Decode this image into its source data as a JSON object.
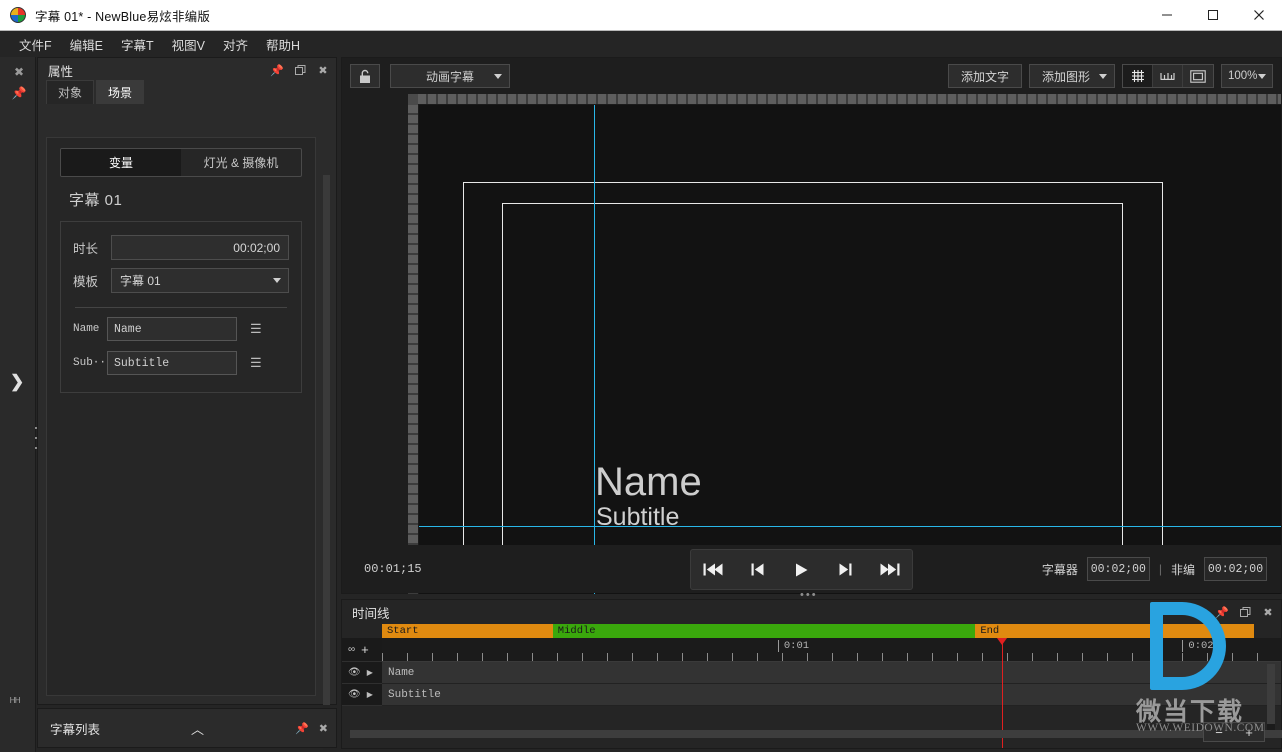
{
  "window": {
    "title": "字幕 01* - NewBlue易炫非编版",
    "logo_icon": "app-logo-icon",
    "minimize_icon": "minimize-icon",
    "maximize_icon": "maximize-icon",
    "close_icon": "close-icon"
  },
  "menu": {
    "items": [
      {
        "label": "文件F"
      },
      {
        "label": "编辑E"
      },
      {
        "label": "字幕T"
      },
      {
        "label": "视图V"
      },
      {
        "label": "对齐"
      },
      {
        "label": "帮助H"
      }
    ]
  },
  "left_rail": {
    "close_icon": "close-icon",
    "pin_icon": "pin-icon",
    "expand_icon": "chevron-right-icon",
    "bottom_icon": "panel-icon"
  },
  "properties": {
    "title": "属性",
    "pin_icon": "pin-icon",
    "restore_icon": "restore-icon",
    "close_icon": "close-icon",
    "tabs": [
      {
        "label": "对象",
        "active": false
      },
      {
        "label": "场景",
        "active": true
      }
    ],
    "segment": [
      {
        "label": "变量",
        "active": true
      },
      {
        "label": "灯光 & 摄像机",
        "active": false
      }
    ],
    "scene_name": "字幕 01",
    "duration_label": "时长",
    "duration_value": "00:02;00",
    "template_label": "模板",
    "template_value": "字幕 01",
    "template_caret": "chevron-down-icon",
    "variables": [
      {
        "label": "Name",
        "value": "Name",
        "menu_icon": "equals-icon"
      },
      {
        "label": "Sub···",
        "value": "Subtitle",
        "menu_icon": "equals-icon"
      }
    ]
  },
  "subtitle_list": {
    "title": "字幕列表",
    "collapse_icon": "chevron-up-icon",
    "pin_icon": "pin-icon",
    "close_icon": "close-icon"
  },
  "stage": {
    "lock_icon": "lock-open-icon",
    "mode_value": "动画字幕",
    "mode_caret": "chevron-down-icon",
    "add_text_label": "添加文字",
    "add_shape_label": "添加图形",
    "add_shape_caret": "chevron-down-icon",
    "view_buttons": [
      {
        "icon": "grid-icon",
        "active": true
      },
      {
        "icon": "ruler-icon",
        "active": false
      },
      {
        "icon": "safe-area-icon",
        "active": false
      }
    ],
    "zoom_value": "100%",
    "zoom_caret": "chevron-down-icon",
    "canvas": {
      "name_text": "Name",
      "subtitle_text": "Subtitle",
      "guide_color": "#29b6e8",
      "safe_border_color": "#e8e8e8"
    }
  },
  "transport": {
    "current_time": "00:01;15",
    "buttons": [
      {
        "icon": "skip-start-icon"
      },
      {
        "icon": "step-back-icon"
      },
      {
        "icon": "play-icon"
      },
      {
        "icon": "step-forward-icon"
      },
      {
        "icon": "skip-end-icon"
      }
    ],
    "titler_label": "字幕器",
    "titler_time": "00:02;00",
    "nle_label": "非编",
    "nle_time": "00:02;00"
  },
  "timeline": {
    "title": "时间线",
    "pin_icon": "pin-icon",
    "restore_icon": "restore-icon",
    "close_icon": "close-icon",
    "loop_icon": "loop-icon",
    "add_icon": "plus-icon",
    "segments": [
      {
        "label": "Start",
        "color": "#e08a10",
        "left_pct": 0,
        "width_pct": 19
      },
      {
        "label": "Middle",
        "color": "#3aa80c",
        "left_pct": 19,
        "width_pct": 47
      },
      {
        "label": "End",
        "color": "#e08a10",
        "left_pct": 66,
        "width_pct": 31
      }
    ],
    "marks": [
      {
        "label": "0:01",
        "left_pct": 44
      },
      {
        "label": "0:02",
        "left_pct": 89
      }
    ],
    "playhead_pct": 69,
    "tracks": [
      {
        "name": "Name",
        "eye_icon": "eye-icon",
        "expand_icon": "caret-right-icon"
      },
      {
        "name": "Subtitle",
        "eye_icon": "eye-icon",
        "expand_icon": "caret-right-icon"
      }
    ],
    "zoom_out_label": "−",
    "zoom_in_label": "+"
  },
  "watermark": {
    "brand_cn": "微当下载",
    "url": "WWW.WEIDOWN.COM",
    "color": "#29a3e0"
  }
}
